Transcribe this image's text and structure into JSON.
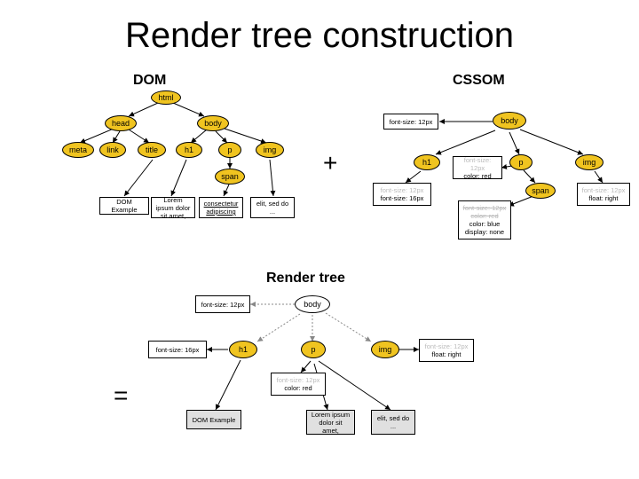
{
  "title": "Render tree construction",
  "sections": {
    "dom": {
      "label": "DOM"
    },
    "cssom": {
      "label": "CSSOM"
    },
    "render": {
      "label": "Render tree"
    }
  },
  "operators": {
    "plus": "+",
    "equals": "="
  },
  "dom_tree": {
    "html": "html",
    "head": "head",
    "body": "body",
    "meta": "meta",
    "link": "link",
    "title": "title",
    "h1": "h1",
    "p": "p",
    "img": "img",
    "span": "span",
    "leaf_title": "DOM Example",
    "leaf_h1": "Lorem ipsum dolor sit amet,",
    "leaf_span": "consectetur adipiscing",
    "leaf_img": "elit, sed do ..."
  },
  "cssom_tree": {
    "body": "body",
    "h1": "h1",
    "p": "p",
    "span": "span",
    "img": "img",
    "body_css": "font-size: 12px",
    "h1_css_muted": "font-size: 12px",
    "h1_css": "font-size: 16px",
    "p_css_muted": "font-size: 12px",
    "p_css": "color: red",
    "img_css_muted": "font-size: 12px",
    "img_css": "float: right",
    "span_css_muted1": "font-size: 12px",
    "span_css_muted2": "color: red",
    "span_css1": "color: blue",
    "span_css2": "display: none"
  },
  "render_tree": {
    "body": "body",
    "h1": "h1",
    "p": "p",
    "img": "img",
    "body_css": "font-size: 12px",
    "h1_css": "font-size: 16px",
    "p_css_muted": "font-size: 12px",
    "p_css": "color: red",
    "img_css_muted": "font-size: 12px",
    "img_css": "float: right",
    "leaf_h1": "DOM Example",
    "leaf_p": "Lorem ipsum dolor sit amet,",
    "leaf_img": "elit, sed do ..."
  }
}
